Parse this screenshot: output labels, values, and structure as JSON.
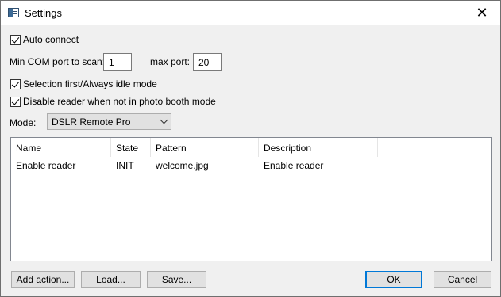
{
  "window": {
    "title": "Settings",
    "icon": "settings-window-icon",
    "close_glyph": "✕"
  },
  "settings": {
    "auto_connect": {
      "label": "Auto connect",
      "checked": true
    },
    "min_com_port": {
      "label": "Min COM port to scan:",
      "value": "1"
    },
    "max_port": {
      "label": "max port:",
      "value": "20"
    },
    "selection_first": {
      "label": "Selection first/Always idle mode",
      "checked": true
    },
    "disable_reader": {
      "label": "Disable reader when not in photo booth mode",
      "checked": true
    },
    "mode": {
      "label": "Mode:",
      "selected": "DSLR Remote Pro"
    }
  },
  "actions_table": {
    "columns": [
      "Name",
      "State",
      "Pattern",
      "Description"
    ],
    "rows": [
      [
        "Enable reader",
        "INIT",
        "welcome.jpg",
        "Enable reader"
      ]
    ]
  },
  "buttons": {
    "add_action": "Add action...",
    "load": "Load...",
    "save": "Save...",
    "ok": "OK",
    "cancel": "Cancel"
  },
  "colors": {
    "default_button_border": "#0078d7",
    "dialog_background": "#f0f0f0"
  }
}
